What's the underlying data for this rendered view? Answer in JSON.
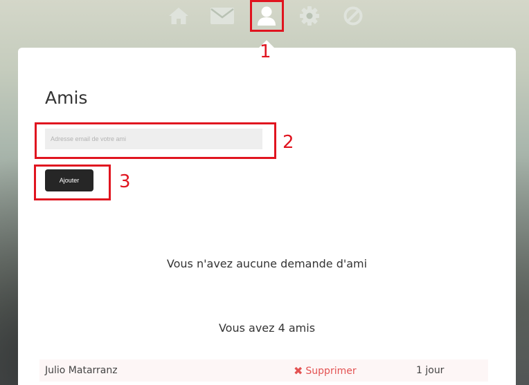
{
  "nav": {
    "items": [
      {
        "icon": "home-icon"
      },
      {
        "icon": "mail-icon"
      },
      {
        "icon": "user-icon",
        "active": true
      },
      {
        "icon": "gear-icon"
      },
      {
        "icon": "block-icon"
      }
    ],
    "inactive_color": "#dfe3dc",
    "active_color": "#ffffff"
  },
  "annotations": {
    "label_1": "1",
    "label_2": "2",
    "label_3": "3",
    "color": "#e0141f"
  },
  "friends_page": {
    "title": "Amis",
    "email_placeholder": "Adresse email de votre ami",
    "add_button_label": "Ajouter",
    "no_requests_text": "Vous n'avez aucune demande d'ami",
    "friends_count_text": "Vous avez 4 amis",
    "friends": [
      {
        "name": "Julio Matarranz",
        "delete_label": "Supprimer",
        "delete_icon": "x-icon",
        "since": "1 jour"
      }
    ]
  }
}
